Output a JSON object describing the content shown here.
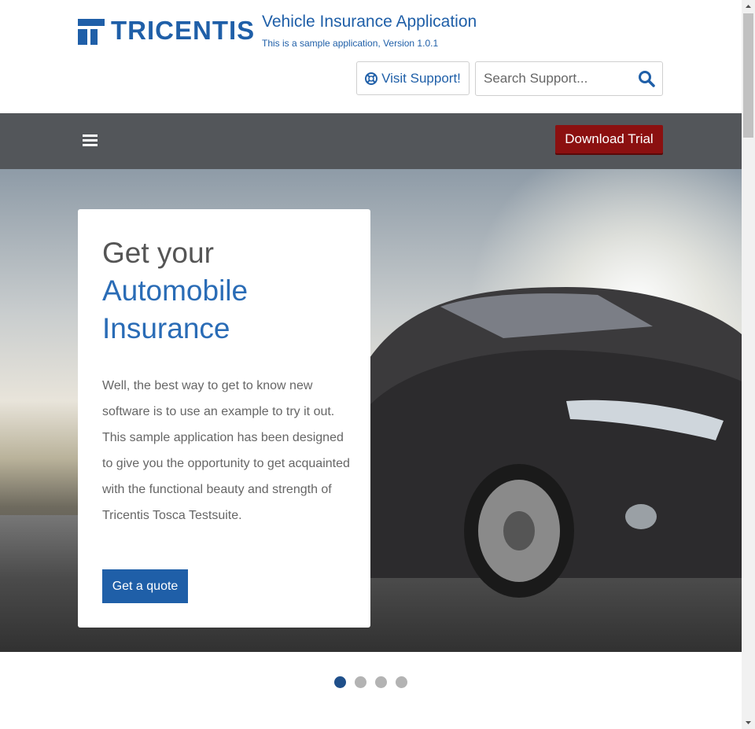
{
  "header": {
    "logo_text": "TRICENTIS",
    "app_title": "Vehicle Insurance Application",
    "app_subtitle": "This is a sample application, Version 1.0.1",
    "support_button_label": "Visit Support!",
    "search_placeholder": "Search Support..."
  },
  "navbar": {
    "menu_icon": "hamburger-menu-icon",
    "download_label": "Download Trial"
  },
  "hero": {
    "title_line1": "Get your",
    "title_line2": "Automobile",
    "title_line3": "Insurance",
    "body": "Well, the best way to get to know new software is to use an example to try it out. This sample application has been designed to give you the opportunity to get acquainted with the functional beauty and strength of Tricentis Tosca Testsuite.",
    "cta_label": "Get a quote"
  },
  "carousel": {
    "slide_count": 4,
    "active_index": 0
  },
  "colors": {
    "brand": "#1f5fa8",
    "navbar": "#53565a",
    "trial_button": "#8b1010",
    "active_dot": "#1f4f8a"
  }
}
